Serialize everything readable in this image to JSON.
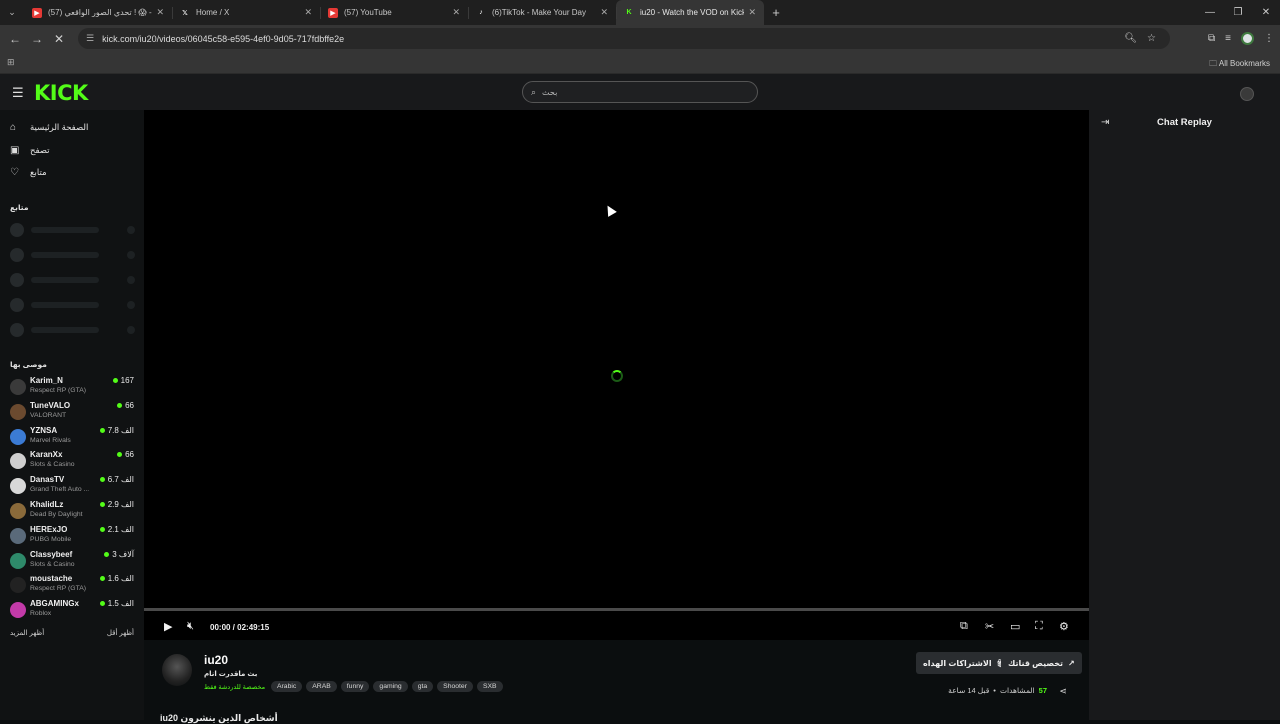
{
  "browser": {
    "tabs": [
      {
        "title": "(57) تحدي الصور الواقعي ! 😱 -",
        "fav_color": "#e53935",
        "fav_glyph": "▶"
      },
      {
        "title": "Home / X",
        "fav_color": "#000000",
        "fav_glyph": "X"
      },
      {
        "title": "(57) YouTube",
        "fav_color": "#e53935",
        "fav_glyph": "▶"
      },
      {
        "title": "(6)TikTok - Make Your Day",
        "fav_color": "#000000",
        "fav_glyph": "♪"
      },
      {
        "title": "iu20 - Watch the VOD on Kick",
        "fav_color": "#53fc18",
        "fav_glyph": "K"
      }
    ],
    "url": "kick.com/iu20/videos/06045c58-e595-4ef0-9d05-717fdbffe2e",
    "bookmarks_label": "All Bookmarks"
  },
  "header": {
    "logo": "KICK",
    "search_placeholder": "بحث"
  },
  "sidebar": {
    "nav": [
      {
        "label": "الصفحة الرئيسية",
        "icon": "home-icon",
        "glyph": "⌂"
      },
      {
        "label": "تصفح",
        "icon": "browse-icon",
        "glyph": "▣"
      },
      {
        "label": "متابع",
        "icon": "heart-icon",
        "glyph": "♡"
      }
    ],
    "following_title": "متابع",
    "recommended_title": "موصى بها",
    "recommended": [
      {
        "name": "Karim_N",
        "category": "Respect RP (GTA)",
        "viewers": "167",
        "color": "#3a3a3a"
      },
      {
        "name": "TuneVALO",
        "category": "VALORANT",
        "viewers": "66",
        "color": "#6b4a2f"
      },
      {
        "name": "YZNSA",
        "category": "Marvel Rivals",
        "viewers": "7.8 الف",
        "color": "#3b7bd4"
      },
      {
        "name": "KaranXx",
        "category": "Slots & Casino",
        "viewers": "66",
        "color": "#cfcfcf"
      },
      {
        "name": "DanasTV",
        "category": "Grand Theft Auto ...",
        "viewers": "6.7 الف",
        "color": "#d8d8d8"
      },
      {
        "name": "KhalidLz",
        "category": "Dead By Daylight",
        "viewers": "2.9 الف",
        "color": "#8a6a3a"
      },
      {
        "name": "HERExJO",
        "category": "PUBG Mobile",
        "viewers": "2.1 الف",
        "color": "#5a6a7a"
      },
      {
        "name": "Classybeef",
        "category": "Slots & Casino",
        "viewers": "3 آلاف",
        "color": "#2e8a6a"
      },
      {
        "name": "moustache",
        "category": "Respect RP (GTA)",
        "viewers": "1.6 الف",
        "color": "#222222"
      },
      {
        "name": "ABGAMINGx",
        "category": "Roblox",
        "viewers": "1.5 الف",
        "color": "#c23aa8"
      }
    ],
    "show_more": "أظهر المزيد",
    "show_less": "أظهر أقل"
  },
  "player": {
    "time": "00:00 / 02:49:15",
    "progress": 0
  },
  "chat": {
    "title": "Chat Replay"
  },
  "vod": {
    "channel": "iu20",
    "title": "بث ماقدرت انام",
    "category": "مخصصة للدردشة فقط",
    "tags": [
      "Arabic",
      "ARAB",
      "funny",
      "gaming",
      "gta",
      "Shooter",
      "SXB"
    ],
    "subscribe_label": "الاشتراكات الهداه",
    "custom_label": "تخصيص قناتك",
    "time_ago": "قبل 14 ساعة",
    "views_label": "المشاهدات",
    "views": "57",
    "below_text": "iu20 أشخاص الذين ينشرون"
  },
  "colors": {
    "accent": "#53fc18",
    "background": "#0b0e0f"
  }
}
